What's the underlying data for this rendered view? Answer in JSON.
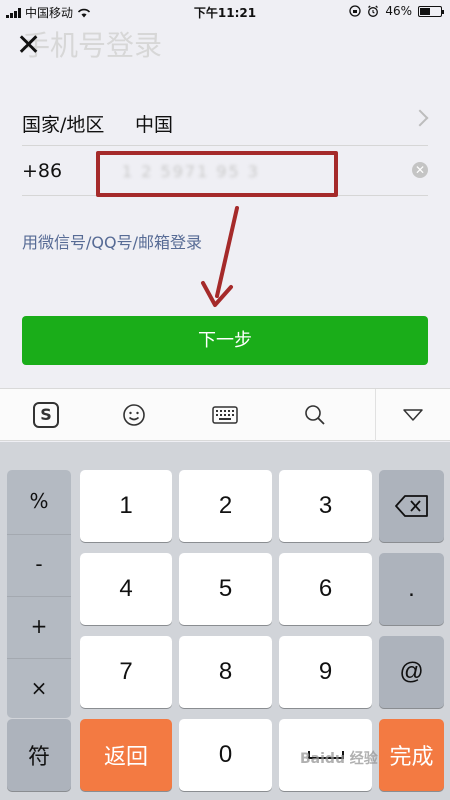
{
  "status_bar": {
    "carrier": "中国移动",
    "time": "下午11:21",
    "battery": "46%",
    "battery_level": 0.46
  },
  "header": {
    "close_icon": "close-icon",
    "title": "手机号登录"
  },
  "country_row": {
    "label": "国家/地区",
    "value": "中国"
  },
  "phone_row": {
    "prefix": "+86",
    "value": "1 2 5971 95 3"
  },
  "alt_login": "用微信号/QQ号/邮箱登录",
  "next_button": "下一步",
  "keyboard": {
    "toolbar": [
      "sogou-logo-icon",
      "emoji-icon",
      "keyboard-icon",
      "search-icon",
      "hide-keyboard-icon"
    ],
    "symbols": [
      "%",
      "-",
      "+",
      "×"
    ],
    "digits": [
      "1",
      "2",
      "3",
      "4",
      "5",
      "6",
      "7",
      "8",
      "9"
    ],
    "dot": ".",
    "at": "@",
    "fu": "符",
    "back": "返回",
    "zero": "0",
    "done": "完成"
  },
  "watermark": "Baidu 经验",
  "colors": {
    "accent_green": "#1aad19",
    "link_blue": "#576b95",
    "annotation_red": "#a52a2a",
    "key_orange": "#f37a42"
  }
}
